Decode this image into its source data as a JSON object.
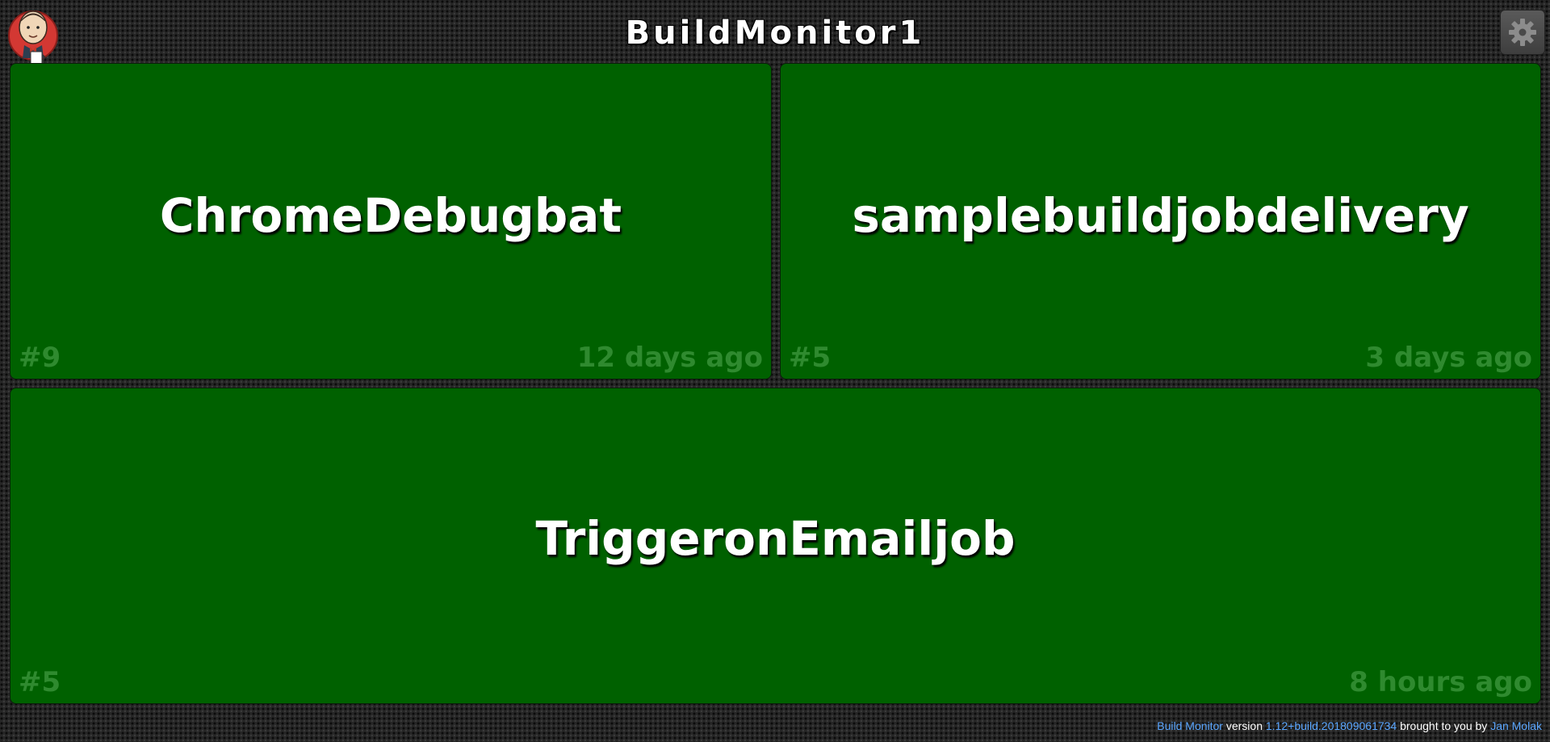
{
  "header": {
    "title": "BuildMonitor1",
    "logo_icon": "jenkins-butler-logo-icon",
    "settings_icon": "gear-icon"
  },
  "jobs": [
    {
      "name": "ChromeDebugbat",
      "build": "#9",
      "ago": "12 days ago",
      "status": "success"
    },
    {
      "name": "samplebuildjobdelivery",
      "build": "#5",
      "ago": "3 days ago",
      "status": "success"
    },
    {
      "name": "TriggeronEmailjob",
      "build": "#5",
      "ago": "8 hours ago",
      "status": "success"
    }
  ],
  "footer": {
    "product_link": "Build Monitor",
    "version_label": "version",
    "version_link": "1.12+build.201809061734",
    "brought_label": "brought to you by",
    "author_link": "Jan Molak"
  },
  "colors": {
    "tile_success": "#006100",
    "tile_meta_text": "#2f8a2f",
    "footer_link": "#5aa6ff"
  }
}
